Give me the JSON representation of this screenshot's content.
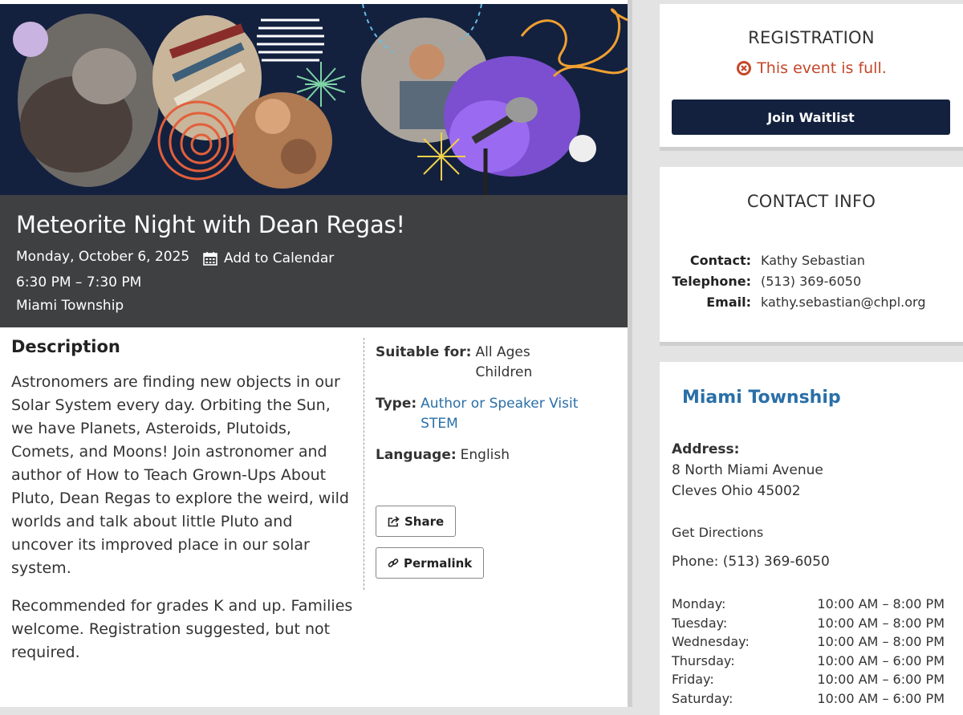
{
  "event": {
    "title": "Meteorite Night with Dean Regas!",
    "date": "Monday, October 6, 2025",
    "add_to_calendar": "Add to Calendar",
    "time": "6:30 PM – 7:30 PM",
    "location": "Miami Township"
  },
  "description": {
    "heading": "Description",
    "paragraphs": [
      "Astronomers are finding new objects in our Solar System every day. Orbiting the Sun, we have Planets, Asteroids, Plutoids, Comets, and Moons! Join astronomer and author of How to Teach Grown-Ups About Pluto, Dean Regas to explore the weird, wild worlds and talk about little Pluto and uncover its improved place in our solar system.",
      "Recommended for grades K and up. Families welcome.  Registration suggested, but not required."
    ]
  },
  "details": {
    "suitable_label": "Suitable for:",
    "suitable_values": [
      "All Ages",
      "Children"
    ],
    "type_label": "Type:",
    "type_values": [
      "Author or Speaker Visit",
      "STEM"
    ],
    "language_label": "Language:",
    "language_value": "English",
    "share_label": "Share",
    "permalink_label": "Permalink"
  },
  "registration": {
    "heading": "REGISTRATION",
    "status": "This event is full.",
    "button": "Join Waitlist"
  },
  "contact": {
    "heading": "CONTACT INFO",
    "contact_label": "Contact:",
    "contact_value": "Kathy Sebastian",
    "telephone_label": "Telephone:",
    "telephone_value": "(513) 369-6050",
    "email_label": "Email:",
    "email_value": "kathy.sebastian@chpl.org"
  },
  "branch": {
    "name": "Miami Township",
    "address_label": "Address:",
    "address_line1": "8 North Miami Avenue",
    "address_line2": "Cleves Ohio 45002",
    "directions": "Get Directions",
    "phone": "Phone: (513) 369-6050",
    "hours": [
      {
        "day": "Monday:",
        "time": "10:00 AM – 8:00 PM"
      },
      {
        "day": "Tuesday:",
        "time": "10:00 AM – 8:00 PM"
      },
      {
        "day": "Wednesday:",
        "time": "10:00 AM – 8:00 PM"
      },
      {
        "day": "Thursday:",
        "time": "10:00 AM – 6:00 PM"
      },
      {
        "day": "Friday:",
        "time": "10:00 AM – 6:00 PM"
      },
      {
        "day": "Saturday:",
        "time": "10:00 AM – 6:00 PM"
      }
    ]
  },
  "colors": {
    "navy": "#13213f",
    "title_bar": "#3e4042",
    "link": "#2a6fa8",
    "alert": "#c4472a"
  }
}
